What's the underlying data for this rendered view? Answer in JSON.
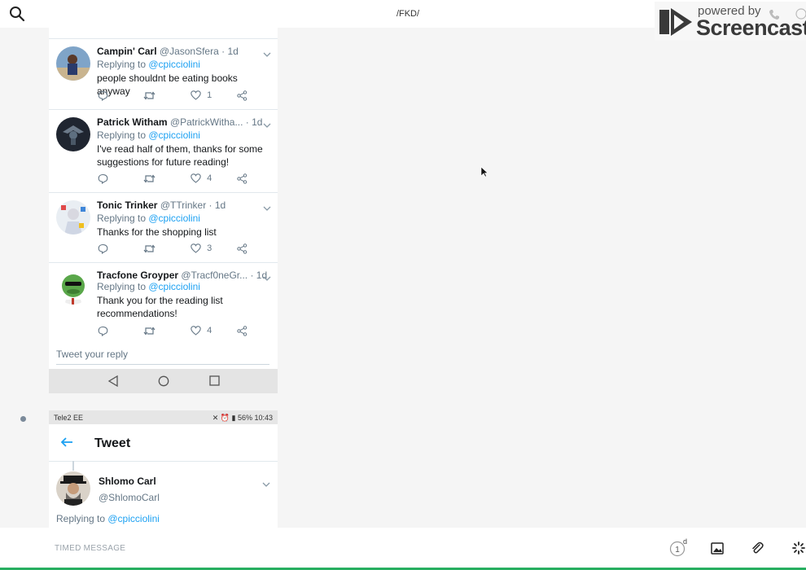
{
  "topbar": {
    "title": "/FKD/"
  },
  "screencastify": {
    "powered": "powered by",
    "name": "Screencastify"
  },
  "tweets": [
    {
      "name": "Campin' Carl",
      "handle": "@JasonSfera · 1d",
      "replying": "Replying to ",
      "mention": "@cpicciolini",
      "text": "people shouldnt be eating books anyway",
      "likes": "1"
    },
    {
      "name": "Patrick Witham",
      "handle": "@PatrickWitha... · 1d",
      "replying": "Replying to ",
      "mention": "@cpicciolini",
      "text": "I've read half of them, thanks for some suggestions for future reading!",
      "likes": "4"
    },
    {
      "name": "Tonic Trinker",
      "handle": "@TTrinker · 1d",
      "replying": "Replying to ",
      "mention": "@cpicciolini",
      "text": "Thanks for the shopping list",
      "likes": "3"
    },
    {
      "name": "Tracfone Groyper",
      "handle": "@Tracf0neGr... · 1d",
      "replying": "Replying to ",
      "mention": "@cpicciolini",
      "text": "Thank you for the reading list recommendations!",
      "likes": "4"
    }
  ],
  "reply_box": {
    "placeholder": "Tweet your reply"
  },
  "phone2": {
    "carrier": "Tele2 EE",
    "status_right": "56%  10:43",
    "title": "Tweet",
    "author_name": "Shlomo Carl",
    "author_handle": "@ShlomoCarl",
    "replying": "Replying to ",
    "mention": "@cpicciolini"
  },
  "bottombar": {
    "timed_message": "TIMED MESSAGE",
    "timer_value": "1",
    "timer_unit": "d"
  },
  "colors": {
    "link": "#1da1f2",
    "muted": "#657786",
    "accent_bottom": "#27ae60"
  }
}
